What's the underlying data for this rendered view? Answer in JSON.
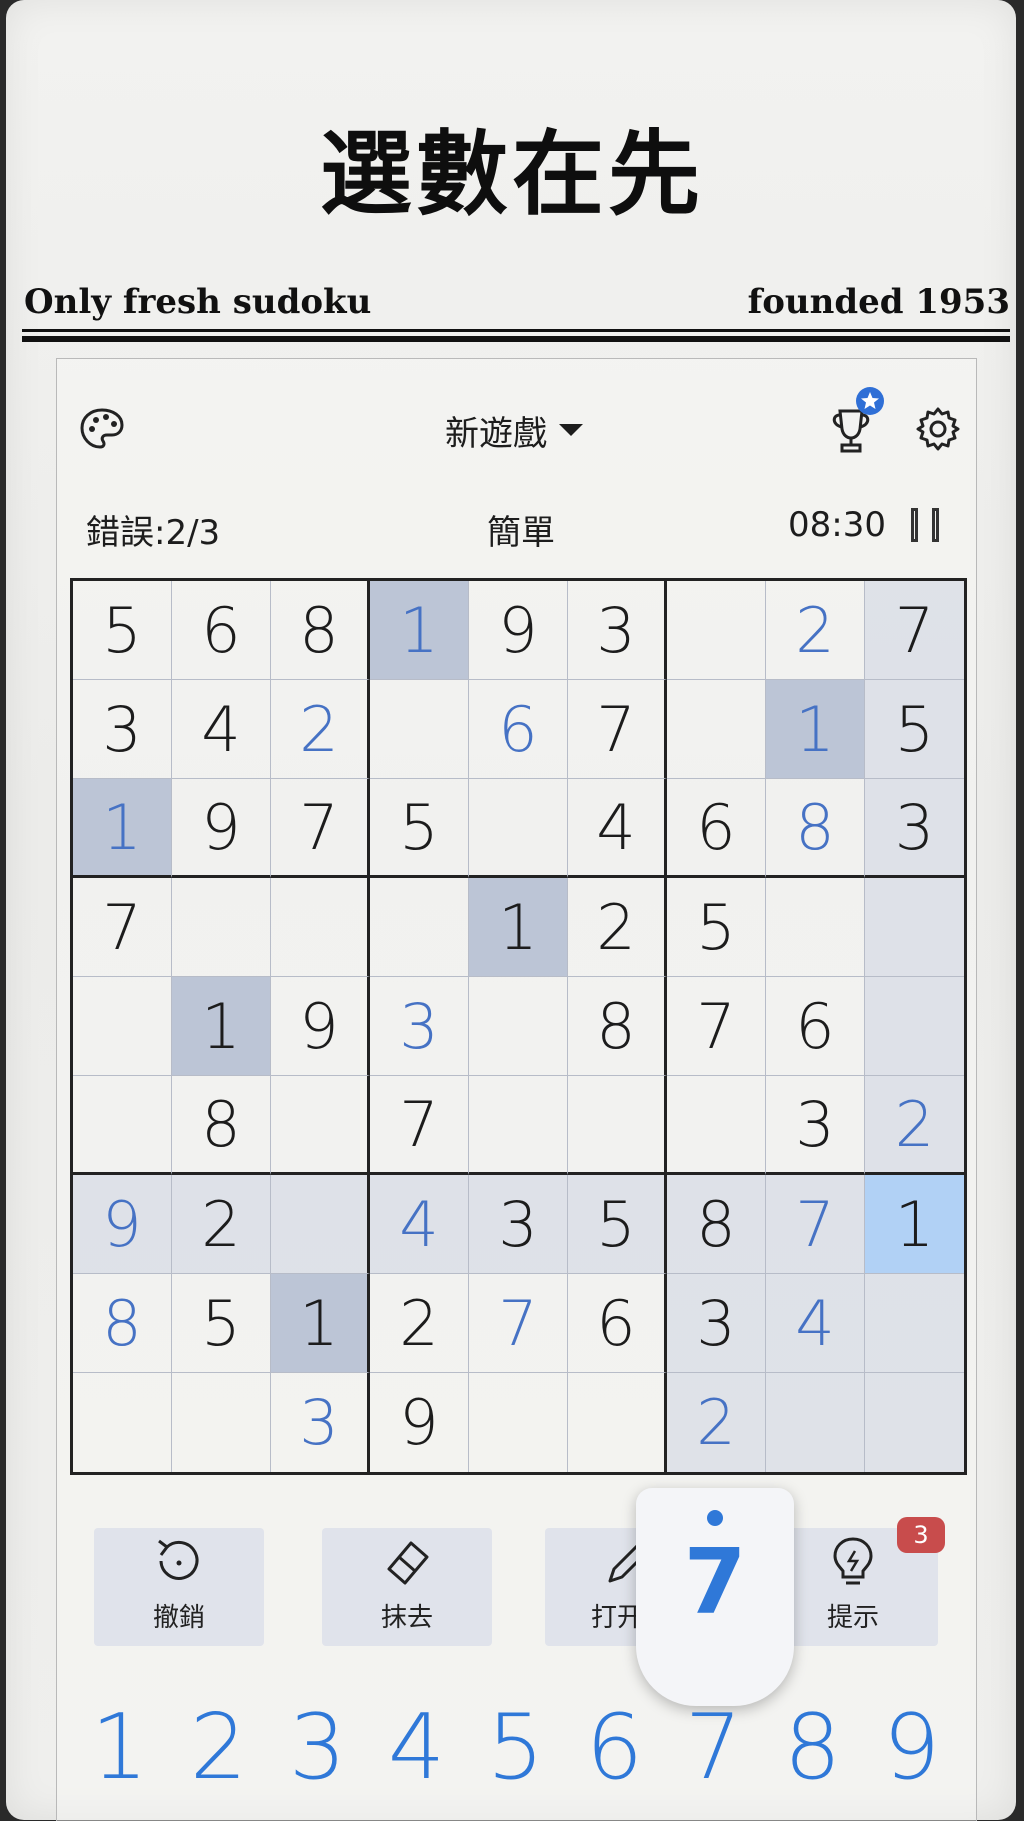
{
  "header": {
    "title": "選數在先",
    "tagline_left": "Only fresh sudoku",
    "tagline_right": "founded 1953"
  },
  "toolbar": {
    "new_game_label": "新遊戲",
    "icons": [
      "palette-icon",
      "trophy-icon",
      "gear-icon"
    ]
  },
  "status": {
    "mistakes": "錯誤:2/3",
    "difficulty": "簡單",
    "timer": "08:30"
  },
  "board": {
    "rows": [
      [
        "5",
        "6",
        "8",
        "1",
        "9",
        "3",
        "",
        "2",
        "7"
      ],
      [
        "3",
        "4",
        "2",
        "",
        "6",
        "7",
        "",
        "1",
        "5"
      ],
      [
        "1",
        "9",
        "7",
        "5",
        "",
        "4",
        "6",
        "8",
        "3"
      ],
      [
        "7",
        "",
        "",
        "",
        "1",
        "2",
        "5",
        "",
        ""
      ],
      [
        "",
        "1",
        "9",
        "3",
        "",
        "8",
        "7",
        "6",
        ""
      ],
      [
        "",
        "8",
        "",
        "7",
        "",
        "",
        "",
        "3",
        "2"
      ],
      [
        "9",
        "2",
        "",
        "4",
        "3",
        "5",
        "8",
        "7",
        "1"
      ],
      [
        "8",
        "5",
        "1",
        "2",
        "7",
        "6",
        "3",
        "4",
        ""
      ],
      [
        "",
        "",
        "3",
        "9",
        "",
        "",
        "2",
        "",
        ""
      ]
    ],
    "user_entered": [
      [
        0,
        0,
        0,
        1,
        0,
        0,
        0,
        1,
        0
      ],
      [
        0,
        0,
        1,
        0,
        1,
        0,
        0,
        1,
        0
      ],
      [
        1,
        0,
        0,
        0,
        0,
        0,
        0,
        1,
        0
      ],
      [
        0,
        0,
        0,
        0,
        0,
        0,
        0,
        0,
        0
      ],
      [
        0,
        0,
        0,
        1,
        0,
        0,
        0,
        0,
        0
      ],
      [
        0,
        0,
        0,
        0,
        0,
        0,
        0,
        0,
        1
      ],
      [
        1,
        0,
        0,
        1,
        0,
        0,
        0,
        1,
        0
      ],
      [
        1,
        0,
        0,
        0,
        1,
        0,
        0,
        1,
        0
      ],
      [
        0,
        0,
        1,
        0,
        0,
        0,
        1,
        0,
        0
      ]
    ],
    "selected_cell": {
      "row": 6,
      "col": 8
    },
    "selected_value": "1"
  },
  "actions": [
    {
      "label": "撤銷",
      "icon": "undo-icon"
    },
    {
      "label": "抹去",
      "icon": "eraser-icon"
    },
    {
      "label": "打开笔",
      "icon": "pencil-icon"
    },
    {
      "label": "提示",
      "icon": "lightbulb-icon"
    }
  ],
  "hint_count": "3",
  "popup_number": "7",
  "numpad": [
    "1",
    "2",
    "3",
    "4",
    "5",
    "6",
    "7",
    "8",
    "9"
  ]
}
